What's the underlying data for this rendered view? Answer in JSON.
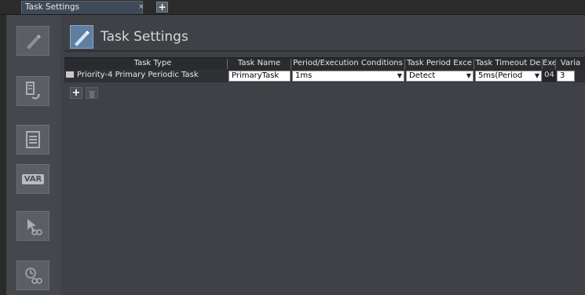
{
  "tabs": {
    "active_tab_label": "Task Settings",
    "close_glyph": "×",
    "add_glyph": "+"
  },
  "sidebar": {
    "items": [
      {
        "name": "pencil-icon"
      },
      {
        "name": "io-map-icon"
      },
      {
        "name": "list-icon"
      },
      {
        "name": "var-icon",
        "label": "VAR"
      },
      {
        "name": "watch-cursor-icon"
      },
      {
        "name": "watch-clock-icon"
      }
    ]
  },
  "header": {
    "title": "Task Settings"
  },
  "table": {
    "columns": [
      "Task Type",
      "Task Name",
      "Period/Execution Conditions",
      "Task Period Exce",
      "Task Timeout De",
      "Exe",
      "Varia"
    ],
    "rows": [
      {
        "task_type": "Priority-4 Primary Periodic Task",
        "task_name": "PrimaryTask",
        "period": "1ms",
        "period_exceeded": "Detect",
        "timeout": "5ms(Period",
        "exe": "04",
        "varia": "3"
      }
    ]
  },
  "actions": {
    "add_glyph": "+"
  }
}
